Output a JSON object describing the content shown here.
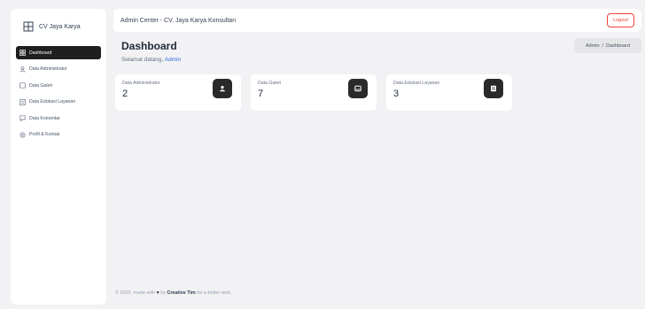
{
  "sidebar": {
    "brand": "CV Jaya Karya",
    "items": [
      {
        "label": "Dashboard",
        "icon": "grid-icon"
      },
      {
        "label": "Data Administrator",
        "icon": "user-icon"
      },
      {
        "label": "Data Galeri",
        "icon": "image-icon"
      },
      {
        "label": "Data Edukasi Layanan",
        "icon": "list-icon"
      },
      {
        "label": "Data Komentar",
        "icon": "comment-icon"
      },
      {
        "label": "Profil & Kontak",
        "icon": "settings-icon"
      }
    ]
  },
  "topbar": {
    "title": "Admin Center - CV. Jaya Karya Konsultan",
    "logout_label": "Logout"
  },
  "header": {
    "title": "Dashboard",
    "welcome": "Selamat datang,",
    "user": "Admin"
  },
  "breadcrumb": {
    "root": "Admin",
    "sep": "/",
    "current": "Dashboard"
  },
  "cards": [
    {
      "label": "Data Administrator",
      "value": "2",
      "icon": "user-icon"
    },
    {
      "label": "Data Galeri",
      "value": "7",
      "icon": "image-icon"
    },
    {
      "label": "Data Edukasi Layanan",
      "value": "3",
      "icon": "list-icon"
    }
  ],
  "footer": {
    "prefix": "© 2025, made with",
    "by": "by",
    "author": "Creative Tim",
    "suffix": "for a better web."
  },
  "colors": {
    "accent": "#2e6bd1",
    "danger": "#f04438",
    "dark": "#1f1f1f"
  }
}
